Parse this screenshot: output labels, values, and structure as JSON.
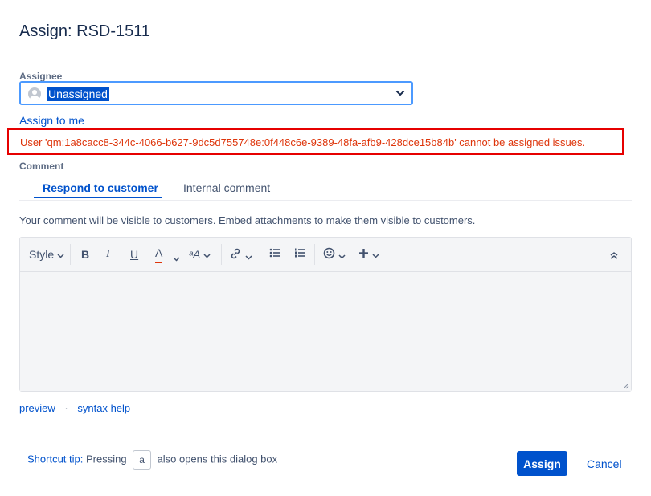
{
  "dialog": {
    "title": "Assign: RSD-1511"
  },
  "assignee": {
    "label": "Assignee",
    "value": "Unassigned",
    "assign_to_me": "Assign to me",
    "error": "User 'qm:1a8cacc8-344c-4066-b627-9dc5d755748e:0f448c6e-9389-48fa-afb9-428dce15b84b' cannot be assigned issues."
  },
  "comment": {
    "label": "Comment",
    "tabs": [
      {
        "label": "Respond to customer",
        "active": true
      },
      {
        "label": "Internal comment",
        "active": false
      }
    ],
    "visibility_note": "Your comment will be visible to customers. Embed attachments to make them visible to customers.",
    "toolbar": {
      "style_label": "Style",
      "bold": "B",
      "italic": "I",
      "underline": "U",
      "color": "A",
      "more_format": "ᵃA"
    },
    "preview_link": "preview",
    "separator": "·",
    "syntax_help_link": "syntax help"
  },
  "footer": {
    "shortcut_label": "Shortcut tip:",
    "shortcut_pressing": "Pressing",
    "shortcut_key": "a",
    "shortcut_suffix": "also opens this dialog box",
    "assign_button": "Assign",
    "cancel_button": "Cancel"
  },
  "colors": {
    "primary": "#0052cc",
    "error": "#de350b",
    "error_border": "#e60000"
  }
}
